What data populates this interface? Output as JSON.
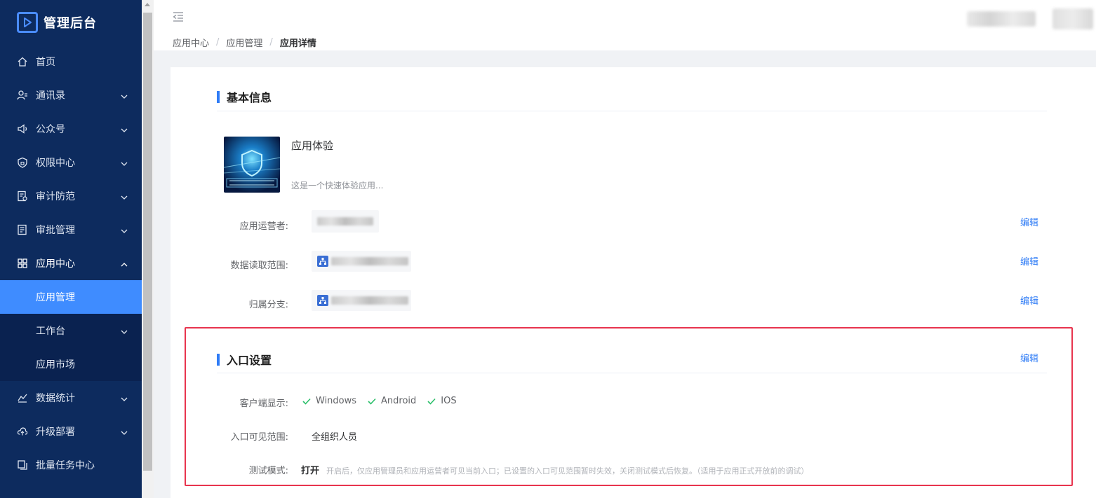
{
  "sidebar": {
    "brand": "管理后台",
    "items": [
      {
        "label": "首页",
        "icon": "home-icon"
      },
      {
        "label": "通讯录",
        "icon": "contacts-icon"
      },
      {
        "label": "公众号",
        "icon": "megaphone-icon"
      },
      {
        "label": "权限中心",
        "icon": "shield-lock-icon"
      },
      {
        "label": "审计防范",
        "icon": "audit-icon"
      },
      {
        "label": "审批管理",
        "icon": "approval-icon"
      },
      {
        "label": "应用中心",
        "icon": "apps-grid-icon"
      },
      {
        "label": "数据统计",
        "icon": "chart-icon"
      },
      {
        "label": "升级部署",
        "icon": "cloud-upload-icon"
      },
      {
        "label": "批量任务中心",
        "icon": "copy-icon"
      }
    ],
    "app_submenu": [
      {
        "label": "应用管理",
        "active": true
      },
      {
        "label": "工作台"
      },
      {
        "label": "应用市场"
      }
    ]
  },
  "header": {
    "breadcrumb": [
      "应用中心",
      "应用管理",
      "应用详情"
    ],
    "separator": "/"
  },
  "basic_info": {
    "title": "基本信息",
    "app_name": "应用体验",
    "app_desc": "这是一个快速体验应用...",
    "fields": [
      {
        "label": "应用运营者:",
        "edit": "编辑"
      },
      {
        "label": "数据读取范围:",
        "edit": "编辑"
      },
      {
        "label": "归属分支:",
        "edit": "编辑"
      }
    ]
  },
  "entry_settings": {
    "title": "入口设置",
    "edit": "编辑",
    "client_label": "客户端显示:",
    "clients": [
      "Windows",
      "Android",
      "IOS"
    ],
    "visibility_label": "入口可见范围:",
    "visibility_value": "全组织人员",
    "test_label": "测试模式:",
    "test_value": "打开",
    "test_note": "开启后，仅应用管理员和应用运营者可见当前入口；已设置的入口可见范围暂时失效，关闭测试模式后恢复。（适用于应用正式开放前的调试）"
  },
  "colors": {
    "sidebar_bg": "#0d2b5e",
    "active_item": "#3f8cff",
    "accent": "#2f7cf6",
    "check": "#2bbf6a",
    "highlight": "#e8344e"
  }
}
